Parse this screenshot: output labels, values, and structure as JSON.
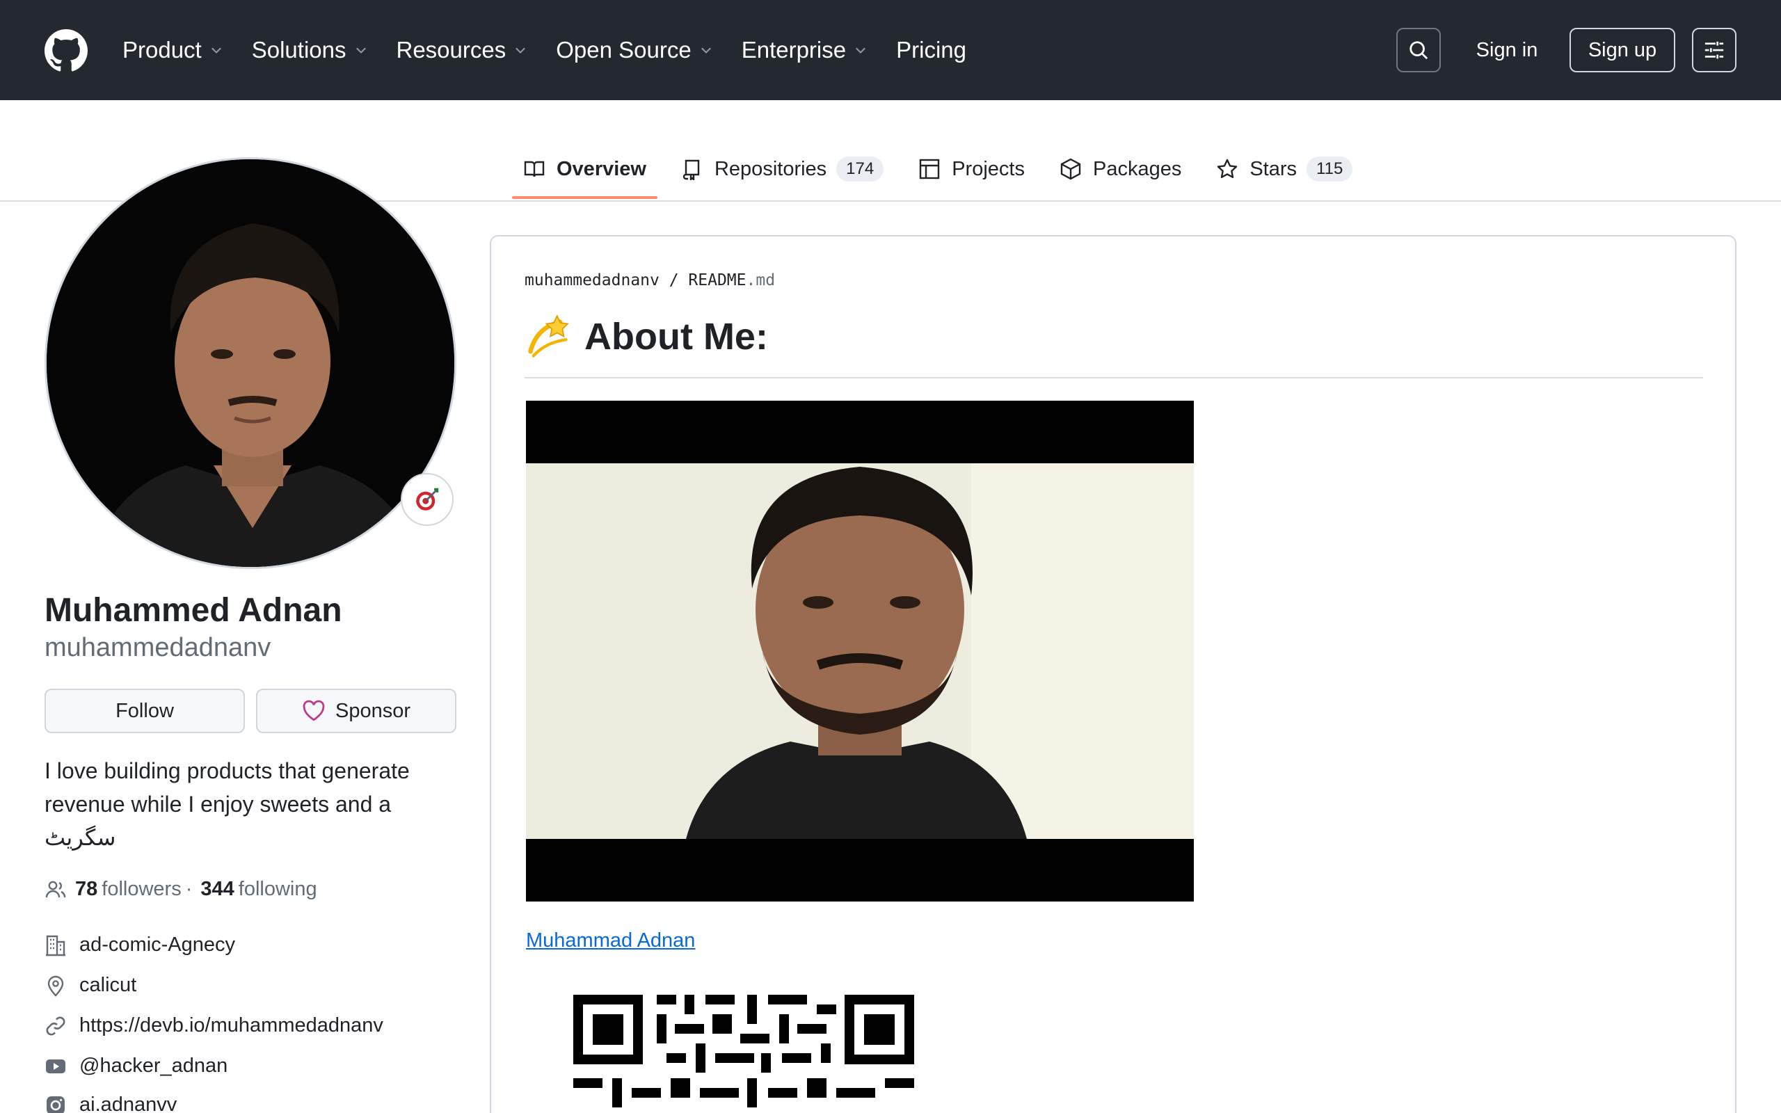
{
  "header": {
    "nav": [
      {
        "label": "Product",
        "dropdown": true
      },
      {
        "label": "Solutions",
        "dropdown": true
      },
      {
        "label": "Resources",
        "dropdown": true
      },
      {
        "label": "Open Source",
        "dropdown": true
      },
      {
        "label": "Enterprise",
        "dropdown": true
      },
      {
        "label": "Pricing",
        "dropdown": false
      }
    ],
    "sign_in": "Sign in",
    "sign_up": "Sign up"
  },
  "tabs": [
    {
      "label": "Overview",
      "count": null,
      "icon": "book-icon",
      "active": true
    },
    {
      "label": "Repositories",
      "count": "174",
      "icon": "repo-icon",
      "active": false
    },
    {
      "label": "Projects",
      "count": null,
      "icon": "table-icon",
      "active": false
    },
    {
      "label": "Packages",
      "count": null,
      "icon": "package-icon",
      "active": false
    },
    {
      "label": "Stars",
      "count": "115",
      "icon": "star-icon",
      "active": false
    }
  ],
  "profile": {
    "name": "Muhammed Adnan",
    "username": "muhammedadnanv",
    "follow_label": "Follow",
    "sponsor_label": "Sponsor",
    "bio": "I love building products that generate revenue while I enjoy sweets and a سگریٹ",
    "followers_count": "78",
    "followers_label": "followers",
    "separator": "·",
    "following_count": "344",
    "following_label": "following",
    "details": [
      {
        "icon": "organization-icon",
        "text": "ad-comic-Agnecy"
      },
      {
        "icon": "location-icon",
        "text": "calicut"
      },
      {
        "icon": "link-icon",
        "text": "https://devb.io/muhammedadnanv"
      },
      {
        "icon": "youtube-icon",
        "text": "@hacker_adnan"
      },
      {
        "icon": "instagram-icon",
        "text": "ai.adnanvv"
      }
    ]
  },
  "readme": {
    "owner": "muhammedadnanv",
    "sep": " / ",
    "file": "README",
    "ext": ".md",
    "title": "About Me:",
    "link_text": "Muhammad Adnan"
  },
  "colors": {
    "header_bg": "#24292f",
    "tab_underline": "#fd8c73",
    "link": "#0969da",
    "sponsor_heart": "#bf3989"
  }
}
